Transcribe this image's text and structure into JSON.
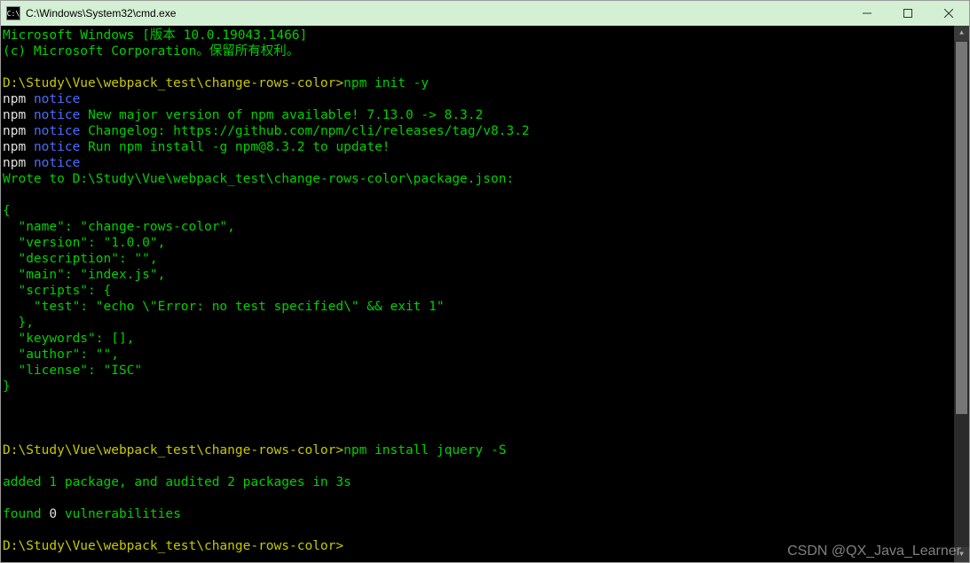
{
  "titlebar": {
    "icon_label": "C:\\",
    "title": "C:\\Windows\\System32\\cmd.exe"
  },
  "terminal": {
    "header1": "Microsoft Windows [版本 10.0.19043.1466]",
    "header2": "(c) Microsoft Corporation。保留所有权利。",
    "prompt_path": "D:\\Study\\Vue\\webpack_test\\change-rows-color>",
    "cmd1": "npm init -y",
    "npm_label": "npm",
    "notice_word": "notice",
    "notice_empty": "",
    "notice_line2": "New major version of npm available! 7.13.0 -> 8.3.2",
    "notice_line3": "Changelog: https://github.com/npm/cli/releases/tag/v8.3.2",
    "notice_line4": "Run npm install -g npm@8.3.2 to update!",
    "wrote_to": "Wrote to D:\\Study\\Vue\\webpack_test\\change-rows-color\\package.json:",
    "json_open": "{",
    "json_name": "  \"name\": \"change-rows-color\",",
    "json_version": "  \"version\": \"1.0.0\",",
    "json_desc": "  \"description\": \"\",",
    "json_main": "  \"main\": \"index.js\",",
    "json_scripts_open": "  \"scripts\": {",
    "json_scripts_test": "    \"test\": \"echo \\\"Error: no test specified\\\" && exit 1\"",
    "json_scripts_close": "  },",
    "json_keywords": "  \"keywords\": [],",
    "json_author": "  \"author\": \"\",",
    "json_license": "  \"license\": \"ISC\"",
    "json_close": "}",
    "cmd2": "npm install jquery -S",
    "added_pkg": "added 1 package, and audited 2 packages in 3s",
    "found_before": "found ",
    "found_zero": "0",
    "found_after": " vulnerabilities"
  },
  "watermark": "CSDN @QX_Java_Learner"
}
